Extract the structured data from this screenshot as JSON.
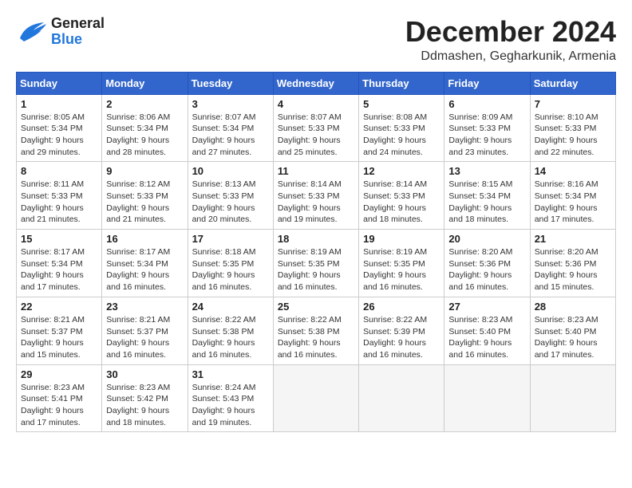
{
  "header": {
    "logo": {
      "general": "General",
      "blue": "Blue"
    },
    "month_title": "December 2024",
    "location": "Ddmashen, Gegharkunik, Armenia"
  },
  "calendar": {
    "days_of_week": [
      "Sunday",
      "Monday",
      "Tuesday",
      "Wednesday",
      "Thursday",
      "Friday",
      "Saturday"
    ],
    "weeks": [
      [
        {
          "day": "1",
          "sunrise": "Sunrise: 8:05 AM",
          "sunset": "Sunset: 5:34 PM",
          "daylight": "Daylight: 9 hours and 29 minutes."
        },
        {
          "day": "2",
          "sunrise": "Sunrise: 8:06 AM",
          "sunset": "Sunset: 5:34 PM",
          "daylight": "Daylight: 9 hours and 28 minutes."
        },
        {
          "day": "3",
          "sunrise": "Sunrise: 8:07 AM",
          "sunset": "Sunset: 5:34 PM",
          "daylight": "Daylight: 9 hours and 27 minutes."
        },
        {
          "day": "4",
          "sunrise": "Sunrise: 8:07 AM",
          "sunset": "Sunset: 5:33 PM",
          "daylight": "Daylight: 9 hours and 25 minutes."
        },
        {
          "day": "5",
          "sunrise": "Sunrise: 8:08 AM",
          "sunset": "Sunset: 5:33 PM",
          "daylight": "Daylight: 9 hours and 24 minutes."
        },
        {
          "day": "6",
          "sunrise": "Sunrise: 8:09 AM",
          "sunset": "Sunset: 5:33 PM",
          "daylight": "Daylight: 9 hours and 23 minutes."
        },
        {
          "day": "7",
          "sunrise": "Sunrise: 8:10 AM",
          "sunset": "Sunset: 5:33 PM",
          "daylight": "Daylight: 9 hours and 22 minutes."
        }
      ],
      [
        {
          "day": "8",
          "sunrise": "Sunrise: 8:11 AM",
          "sunset": "Sunset: 5:33 PM",
          "daylight": "Daylight: 9 hours and 21 minutes."
        },
        {
          "day": "9",
          "sunrise": "Sunrise: 8:12 AM",
          "sunset": "Sunset: 5:33 PM",
          "daylight": "Daylight: 9 hours and 21 minutes."
        },
        {
          "day": "10",
          "sunrise": "Sunrise: 8:13 AM",
          "sunset": "Sunset: 5:33 PM",
          "daylight": "Daylight: 9 hours and 20 minutes."
        },
        {
          "day": "11",
          "sunrise": "Sunrise: 8:14 AM",
          "sunset": "Sunset: 5:33 PM",
          "daylight": "Daylight: 9 hours and 19 minutes."
        },
        {
          "day": "12",
          "sunrise": "Sunrise: 8:14 AM",
          "sunset": "Sunset: 5:33 PM",
          "daylight": "Daylight: 9 hours and 18 minutes."
        },
        {
          "day": "13",
          "sunrise": "Sunrise: 8:15 AM",
          "sunset": "Sunset: 5:34 PM",
          "daylight": "Daylight: 9 hours and 18 minutes."
        },
        {
          "day": "14",
          "sunrise": "Sunrise: 8:16 AM",
          "sunset": "Sunset: 5:34 PM",
          "daylight": "Daylight: 9 hours and 17 minutes."
        }
      ],
      [
        {
          "day": "15",
          "sunrise": "Sunrise: 8:17 AM",
          "sunset": "Sunset: 5:34 PM",
          "daylight": "Daylight: 9 hours and 17 minutes."
        },
        {
          "day": "16",
          "sunrise": "Sunrise: 8:17 AM",
          "sunset": "Sunset: 5:34 PM",
          "daylight": "Daylight: 9 hours and 16 minutes."
        },
        {
          "day": "17",
          "sunrise": "Sunrise: 8:18 AM",
          "sunset": "Sunset: 5:35 PM",
          "daylight": "Daylight: 9 hours and 16 minutes."
        },
        {
          "day": "18",
          "sunrise": "Sunrise: 8:19 AM",
          "sunset": "Sunset: 5:35 PM",
          "daylight": "Daylight: 9 hours and 16 minutes."
        },
        {
          "day": "19",
          "sunrise": "Sunrise: 8:19 AM",
          "sunset": "Sunset: 5:35 PM",
          "daylight": "Daylight: 9 hours and 16 minutes."
        },
        {
          "day": "20",
          "sunrise": "Sunrise: 8:20 AM",
          "sunset": "Sunset: 5:36 PM",
          "daylight": "Daylight: 9 hours and 16 minutes."
        },
        {
          "day": "21",
          "sunrise": "Sunrise: 8:20 AM",
          "sunset": "Sunset: 5:36 PM",
          "daylight": "Daylight: 9 hours and 15 minutes."
        }
      ],
      [
        {
          "day": "22",
          "sunrise": "Sunrise: 8:21 AM",
          "sunset": "Sunset: 5:37 PM",
          "daylight": "Daylight: 9 hours and 15 minutes."
        },
        {
          "day": "23",
          "sunrise": "Sunrise: 8:21 AM",
          "sunset": "Sunset: 5:37 PM",
          "daylight": "Daylight: 9 hours and 16 minutes."
        },
        {
          "day": "24",
          "sunrise": "Sunrise: 8:22 AM",
          "sunset": "Sunset: 5:38 PM",
          "daylight": "Daylight: 9 hours and 16 minutes."
        },
        {
          "day": "25",
          "sunrise": "Sunrise: 8:22 AM",
          "sunset": "Sunset: 5:38 PM",
          "daylight": "Daylight: 9 hours and 16 minutes."
        },
        {
          "day": "26",
          "sunrise": "Sunrise: 8:22 AM",
          "sunset": "Sunset: 5:39 PM",
          "daylight": "Daylight: 9 hours and 16 minutes."
        },
        {
          "day": "27",
          "sunrise": "Sunrise: 8:23 AM",
          "sunset": "Sunset: 5:40 PM",
          "daylight": "Daylight: 9 hours and 16 minutes."
        },
        {
          "day": "28",
          "sunrise": "Sunrise: 8:23 AM",
          "sunset": "Sunset: 5:40 PM",
          "daylight": "Daylight: 9 hours and 17 minutes."
        }
      ],
      [
        {
          "day": "29",
          "sunrise": "Sunrise: 8:23 AM",
          "sunset": "Sunset: 5:41 PM",
          "daylight": "Daylight: 9 hours and 17 minutes."
        },
        {
          "day": "30",
          "sunrise": "Sunrise: 8:23 AM",
          "sunset": "Sunset: 5:42 PM",
          "daylight": "Daylight: 9 hours and 18 minutes."
        },
        {
          "day": "31",
          "sunrise": "Sunrise: 8:24 AM",
          "sunset": "Sunset: 5:43 PM",
          "daylight": "Daylight: 9 hours and 19 minutes."
        },
        null,
        null,
        null,
        null
      ]
    ]
  }
}
